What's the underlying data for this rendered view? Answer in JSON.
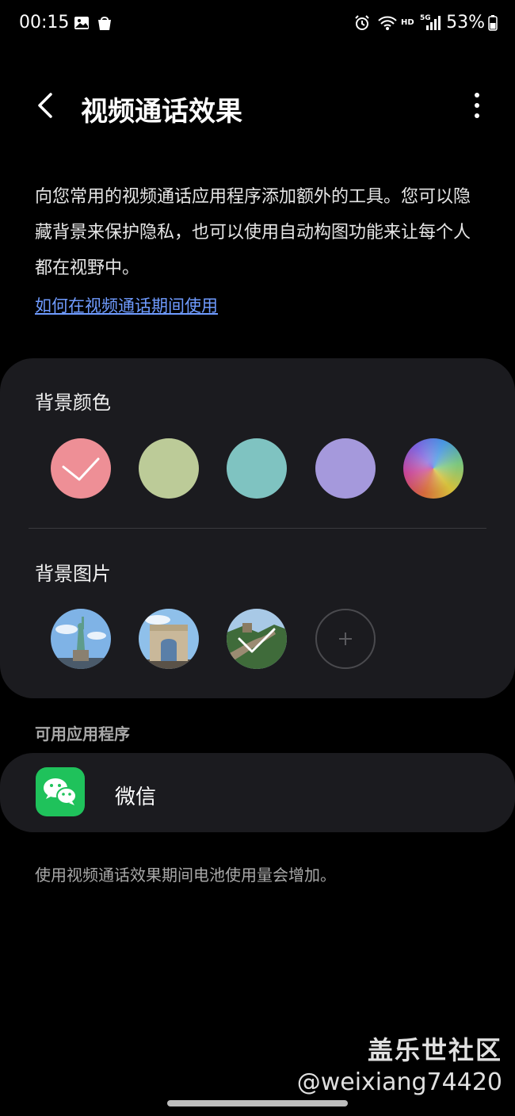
{
  "status_bar": {
    "time": "00:15",
    "network": "HD",
    "signal": "5G",
    "battery": "53%",
    "icons": [
      "gallery-icon",
      "bag-icon",
      "alarm-icon",
      "wifi-icon",
      "signal-icon",
      "battery-icon"
    ]
  },
  "header": {
    "title": "视频通话效果",
    "back_icon": "chevron-left-icon",
    "more_icon": "more-vertical-icon"
  },
  "description": "向您常用的视频通话应用程序添加额外的工具。您可以隐藏背景来保护隐私，也可以使用自动构图功能来让每个人都在视野中。",
  "howto_link": "如何在视频通话期间使用",
  "background_color": {
    "label": "背景颜色",
    "selected_index": 0,
    "swatches": [
      "#ee8f96",
      "#bccb98",
      "#7fc3c1",
      "#a599dc",
      "gradient"
    ]
  },
  "background_image": {
    "label": "背景图片",
    "selected_index": 2,
    "images": [
      "statue-of-liberty",
      "arc-de-triomphe",
      "great-wall"
    ],
    "add_label": "+"
  },
  "available_apps": {
    "label": "可用应用程序",
    "apps": [
      {
        "name": "微信",
        "icon": "wechat-icon"
      }
    ]
  },
  "note": "使用视频通话效果期间电池使用量会增加。",
  "watermark": {
    "line1": "盖乐世社区",
    "line2": "@weixiang74420"
  }
}
